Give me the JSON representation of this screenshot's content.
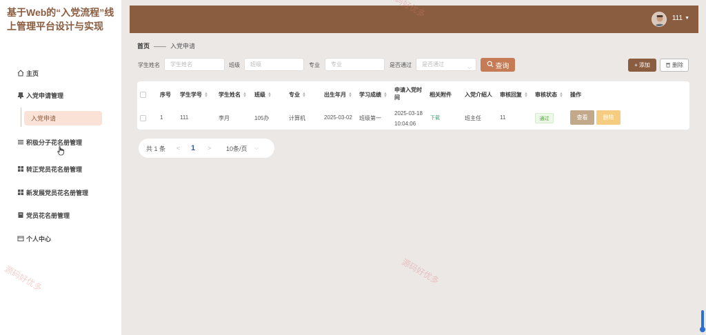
{
  "app": {
    "title": "基于Web的“入党流程”线上管理平台设计与实现"
  },
  "sidebar": {
    "items": [
      {
        "label": "主页",
        "icon": "home-icon"
      },
      {
        "label": "入党申请管理",
        "icon": "stamp-icon"
      },
      {
        "label": "积极分子花名册管理",
        "icon": "list-icon"
      },
      {
        "label": "转正党员花名册管理",
        "icon": "grid-icon"
      },
      {
        "label": "新发展党员花名册管理",
        "icon": "grid-icon"
      },
      {
        "label": "党员花名册管理",
        "icon": "book-icon"
      },
      {
        "label": "个人中心",
        "icon": "card-icon"
      }
    ],
    "sub_items": [
      {
        "label": "入党申请"
      }
    ]
  },
  "header": {
    "user": "111"
  },
  "breadcrumb": {
    "home": "首页",
    "separator": "——",
    "current": "入党申请"
  },
  "search": {
    "name_label": "学生姓名",
    "name_placeholder": "学生姓名",
    "class_label": "班级",
    "class_placeholder": "班级",
    "major_label": "专业",
    "major_placeholder": "专业",
    "passed_label": "是否通过",
    "passed_placeholder": "是否通过",
    "search_button": "查询"
  },
  "toolbar": {
    "add_label": "添加",
    "delete_label": "删除"
  },
  "table": {
    "headers": [
      "序号",
      "学生学号",
      "学生姓名",
      "班级",
      "专业",
      "出生年月",
      "学习成绩",
      "申请入党时间",
      "相关附件",
      "入党介绍人",
      "审核回复",
      "审核状态",
      "操作"
    ],
    "rows": [
      {
        "index": "1",
        "student_id": "111",
        "name": "李月",
        "class": "105办",
        "major": "计算机",
        "birth": "2025-03-02",
        "grade": "班级第一",
        "apply_date": "2025-03-18",
        "apply_time": "10:04:06",
        "attachment": "下载",
        "introducer": "班主任",
        "reply": "11",
        "status": "通过",
        "view_label": "查看",
        "delete_label": "删除"
      }
    ]
  },
  "pagination": {
    "total": "共 1 条",
    "prev": "<",
    "current_page": "1",
    "next": ">",
    "page_size": "10条/页"
  },
  "watermarks": [
    "源码好优多",
    "源码好优多",
    "源码好优多"
  ],
  "colors": {
    "brand": "#8b5d40",
    "search": "#c47b56",
    "view": "#c3a98b",
    "delete": "#f6cd80",
    "status_pass": "#52a23a"
  }
}
